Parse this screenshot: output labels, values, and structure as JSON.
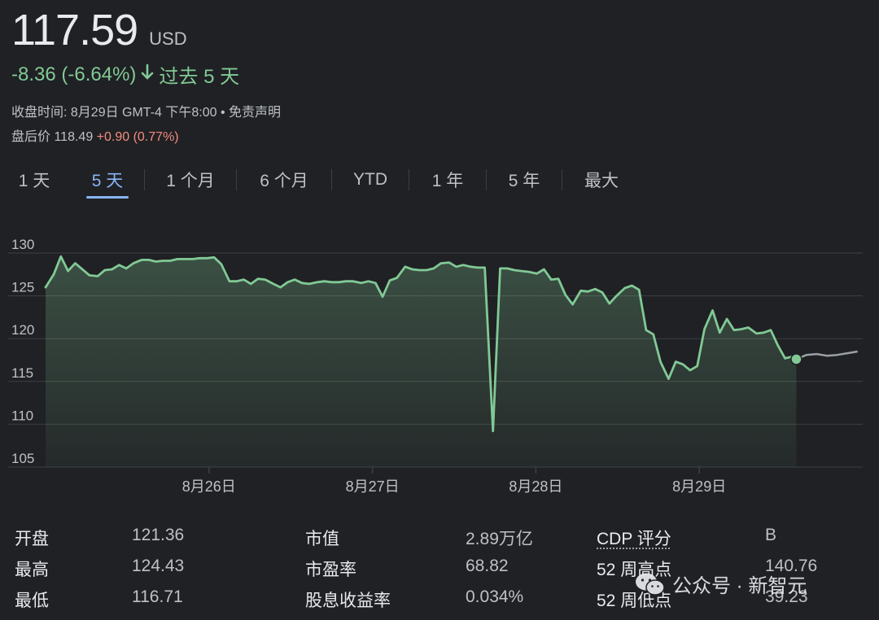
{
  "quote": {
    "price": "117.59",
    "currency": "USD",
    "change": "-8.36 (-6.64%)",
    "period": "过去 5 天",
    "close_time": "收盘时间: 8月29日 GMT-4 下午8:00 • 免责声明",
    "after_hours_label": "盘后价",
    "after_hours_price": "118.49",
    "after_hours_change": "+0.90 (0.77%)"
  },
  "tabs": [
    "1 天",
    "5 天",
    "1 个月",
    "6 个月",
    "YTD",
    "1 年",
    "5 年",
    "最大"
  ],
  "active_tab": 1,
  "colors": {
    "line": "#81c995",
    "after_hours_line": "#9aa0a6",
    "grid": "#3c4043",
    "label": "#bdc1c6",
    "background": "#202124"
  },
  "chart_data": {
    "type": "area",
    "title": "",
    "xlabel": "",
    "ylabel": "",
    "ylim": [
      105,
      130
    ],
    "yticks": [
      105,
      110,
      115,
      120,
      125,
      130
    ],
    "x_tick_labels": [
      "8月26日",
      "8月27日",
      "8月28日",
      "8月29日"
    ],
    "x_tick_positions": [
      16,
      32,
      48,
      64
    ],
    "xlim": [
      0,
      80
    ],
    "grid": true,
    "series": [
      {
        "type": "session",
        "x": [
          0,
          0.8,
          1.5,
          2.2,
          2.9,
          3.6,
          4.3,
          5.1,
          5.8,
          6.5,
          7.2,
          7.9,
          8.6,
          9.4,
          10.1,
          10.8,
          11.5,
          12.2,
          12.9,
          13.7,
          14.4,
          15.1,
          15.8,
          16.5,
          17.2,
          18,
          18.7,
          19.4,
          20.1,
          20.8,
          21.5,
          22.3,
          23,
          23.7,
          24.4,
          25.1,
          25.8,
          26.6,
          27.3,
          28,
          28.7,
          29.4,
          30.1,
          30.9,
          31.6,
          32.3,
          33,
          33.7,
          34.4,
          35.2,
          35.9,
          36.6,
          37.3,
          38,
          38.7,
          39.5,
          40.2,
          40.9,
          41.6,
          42.3,
          43,
          43.8,
          44.5,
          45.2,
          45.9,
          46.6,
          47.3,
          48.1,
          48.8,
          49.5,
          50.2,
          50.9,
          51.6,
          52.4,
          53.1,
          53.8,
          54.5,
          55.2,
          55.9,
          56.7,
          57.4,
          58.1,
          58.8,
          59.5,
          60.2,
          61,
          61.7,
          62.4,
          63.1,
          63.8,
          64.5,
          65.3,
          66,
          66.7,
          67.4,
          68.1,
          68.8,
          69.6,
          70.3,
          71,
          71.7,
          72.4,
          73.1,
          73.5
        ],
        "values": [
          126.0,
          127.5,
          129.6,
          127.9,
          128.8,
          128.1,
          127.4,
          127.3,
          128.0,
          128.1,
          128.6,
          128.2,
          128.8,
          129.2,
          129.2,
          129.0,
          129.1,
          129.1,
          129.3,
          129.3,
          129.3,
          129.4,
          129.4,
          129.5,
          128.7,
          126.7,
          126.7,
          126.9,
          126.4,
          127.0,
          126.9,
          126.4,
          126.0,
          126.6,
          126.9,
          126.5,
          126.4,
          126.6,
          126.7,
          126.6,
          126.6,
          126.7,
          126.7,
          126.5,
          126.7,
          126.5,
          124.9,
          126.8,
          127.1,
          128.4,
          128.1,
          128.0,
          128.0,
          128.2,
          128.8,
          128.9,
          128.4,
          128.6,
          128.4,
          128.3,
          128.3,
          109.2,
          128.2,
          128.2,
          128.0,
          127.9,
          127.8,
          127.6,
          128.1,
          126.9,
          127.0,
          125.1,
          124.0,
          125.6,
          125.5,
          125.8,
          125.4,
          124.1,
          125.0,
          125.9,
          126.2,
          125.7,
          121.0,
          120.5,
          117.3,
          115.3,
          117.3,
          117.0,
          116.3,
          116.8,
          121.1,
          123.3,
          120.7,
          122.3,
          121.0,
          121.1,
          121.3,
          120.6,
          120.7,
          121.0,
          119.2,
          117.7,
          117.9,
          117.6
        ]
      },
      {
        "type": "after_hours",
        "x": [
          73.5,
          74.5,
          75.5,
          76.5,
          77.5,
          78.5,
          79.5
        ],
        "values": [
          117.6,
          118.1,
          118.2,
          118.0,
          118.1,
          118.3,
          118.5
        ]
      }
    ],
    "current_point": {
      "x": 73.5,
      "value": 117.6
    }
  },
  "stats": [
    {
      "label": "开盘",
      "value": "121.36"
    },
    {
      "label": "最高",
      "value": "124.43"
    },
    {
      "label": "最低",
      "value": "116.71"
    },
    {
      "label": "市值",
      "value": "2.89万亿"
    },
    {
      "label": "市盈率",
      "value": "68.82"
    },
    {
      "label": "股息收益率",
      "value": "0.034%"
    },
    {
      "label": "CDP 评分",
      "value": "B"
    },
    {
      "label": "52 周高点",
      "value": "140.76"
    },
    {
      "label": "52 周低点",
      "value": "39.23"
    }
  ],
  "watermark": {
    "icon": "wechat-icon",
    "text": "公众号 · 新智元"
  }
}
